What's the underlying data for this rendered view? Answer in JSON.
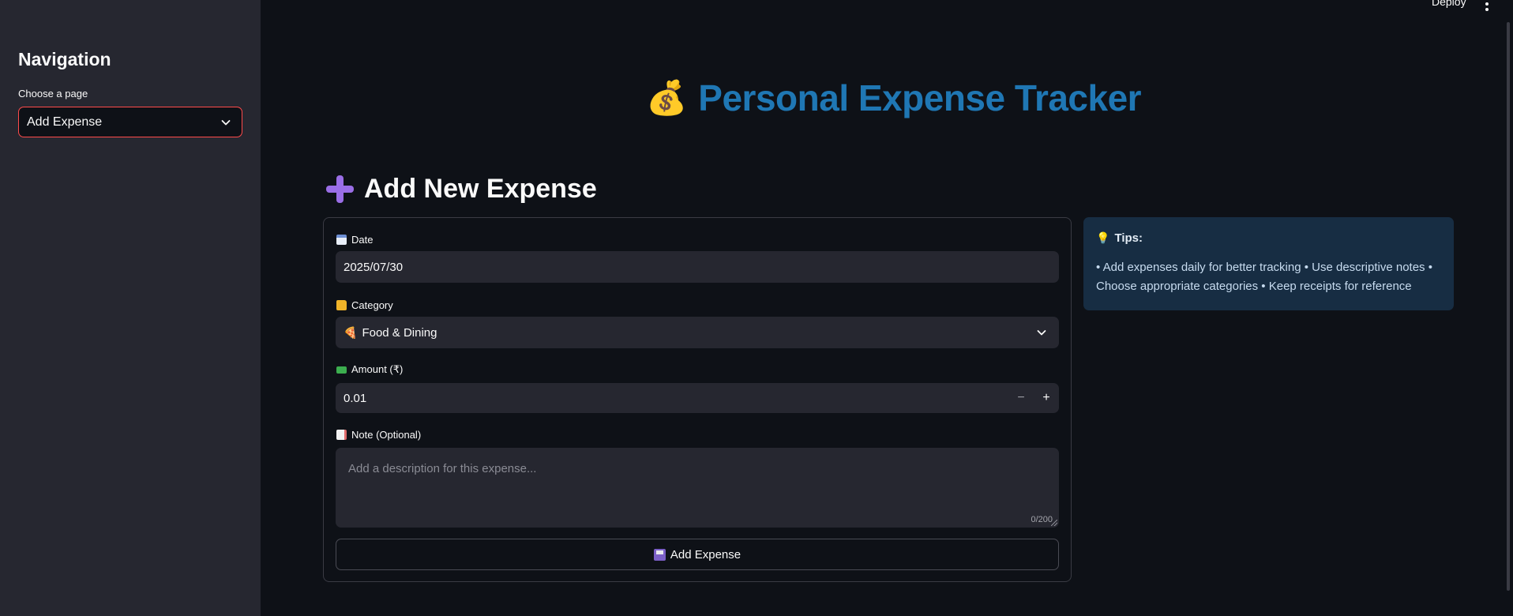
{
  "header": {
    "deploy_label": "Deploy"
  },
  "sidebar": {
    "title": "Navigation",
    "select_label": "Choose a page",
    "selected_page": "Add Expense"
  },
  "app": {
    "title": "Personal Expense Tracker",
    "title_emoji": "💰"
  },
  "form": {
    "heading": "Add New Expense",
    "date": {
      "label": "Date",
      "value": "2025/07/30"
    },
    "category": {
      "label": "Category",
      "value": "Food & Dining",
      "value_emoji": "🍕"
    },
    "amount": {
      "label": "Amount (₹)",
      "value": "0.01",
      "minus": "−",
      "plus": "+"
    },
    "note": {
      "label": "Note (Optional)",
      "placeholder": "Add a description for this expense...",
      "counter": "0/200"
    },
    "submit_label": "Add Expense"
  },
  "tips": {
    "title": "Tips:",
    "body": "• Add expenses daily for better tracking • Use descriptive notes • Choose appropriate categories • Keep receipts for reference"
  },
  "colors": {
    "accent": "#ff4b4b",
    "title_blue": "#1f77b4",
    "background": "#0e1117",
    "sidebar": "#262730",
    "tips_bg": "#172d43"
  }
}
